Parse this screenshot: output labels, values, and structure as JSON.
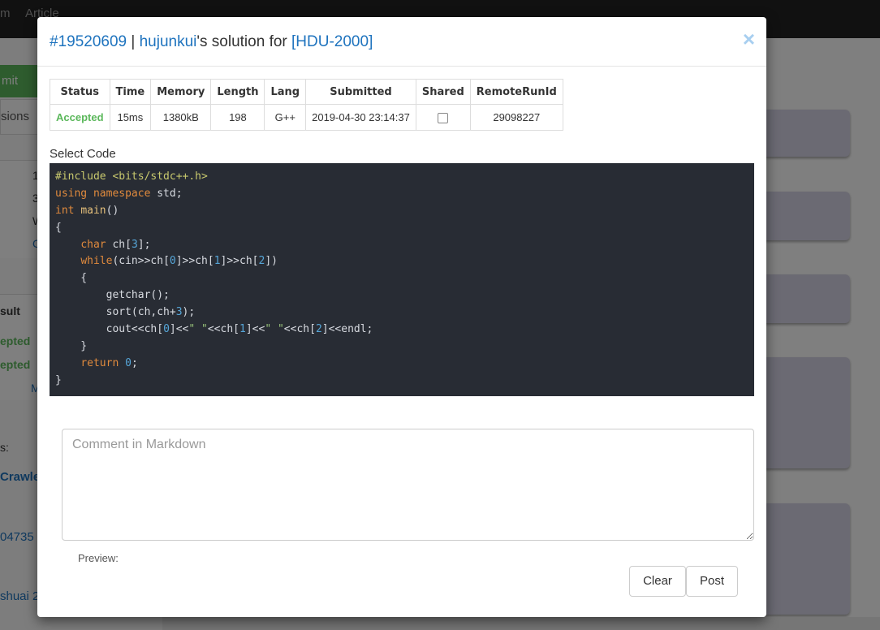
{
  "background": {
    "nav_links": [
      "m",
      "Article"
    ],
    "submit_frag": "mit",
    "tab_frag": "sions",
    "num_frags": [
      "1",
      "3",
      "W",
      "C"
    ],
    "result_header": "sult",
    "result_rows": [
      "epted",
      "epted"
    ],
    "more_frag": "M",
    "label_frag": "s:",
    "link_frag": "Crawle",
    "num_frag": "04735",
    "name_frag": "shuai 2"
  },
  "modal": {
    "title": {
      "run_id": "#19520609",
      "sep": " | ",
      "user": "hujunkui",
      "mid": "'s solution for ",
      "problem": "[HDU-2000]"
    },
    "close_label": "×",
    "table": {
      "headers": [
        "Status",
        "Time",
        "Memory",
        "Length",
        "Lang",
        "Submitted",
        "Shared",
        "RemoteRunId"
      ],
      "row": {
        "status": "Accepted",
        "time": "15ms",
        "memory": "1380kB",
        "length": "198",
        "lang": "G++",
        "submitted": "2019-04-30 23:14:37",
        "remote_run_id": "29098227"
      }
    },
    "select_code_label": "Select Code",
    "comment_placeholder": "Comment in Markdown",
    "preview_label": "Preview:",
    "clear_label": "Clear",
    "post_label": "Post"
  },
  "code_lines": [
    [
      {
        "t": "#include <bits/stdc++.h>",
        "c": "pre"
      }
    ],
    [
      {
        "t": "using namespace",
        "c": "kw"
      },
      {
        "t": " std;",
        "c": ""
      }
    ],
    [
      {
        "t": "int",
        "c": "kw"
      },
      {
        "t": " ",
        "c": ""
      },
      {
        "t": "main",
        "c": "fn"
      },
      {
        "t": "()",
        "c": ""
      }
    ],
    [
      {
        "t": "{",
        "c": ""
      }
    ],
    [
      {
        "t": "    ",
        "c": ""
      },
      {
        "t": "char",
        "c": "kw"
      },
      {
        "t": " ch[",
        "c": ""
      },
      {
        "t": "3",
        "c": "num"
      },
      {
        "t": "];",
        "c": ""
      }
    ],
    [
      {
        "t": "    ",
        "c": ""
      },
      {
        "t": "while",
        "c": "kw"
      },
      {
        "t": "(cin>>ch[",
        "c": ""
      },
      {
        "t": "0",
        "c": "num"
      },
      {
        "t": "]>>ch[",
        "c": ""
      },
      {
        "t": "1",
        "c": "num"
      },
      {
        "t": "]>>ch[",
        "c": ""
      },
      {
        "t": "2",
        "c": "num"
      },
      {
        "t": "])",
        "c": ""
      }
    ],
    [
      {
        "t": "    {",
        "c": ""
      }
    ],
    [
      {
        "t": "        getchar();",
        "c": ""
      }
    ],
    [
      {
        "t": "        sort(ch,ch+",
        "c": ""
      },
      {
        "t": "3",
        "c": "num"
      },
      {
        "t": ");",
        "c": ""
      }
    ],
    [
      {
        "t": "        cout<<ch[",
        "c": ""
      },
      {
        "t": "0",
        "c": "num"
      },
      {
        "t": "]<<",
        "c": ""
      },
      {
        "t": "\" \"",
        "c": "str"
      },
      {
        "t": "<<ch[",
        "c": ""
      },
      {
        "t": "1",
        "c": "num"
      },
      {
        "t": "]<<",
        "c": ""
      },
      {
        "t": "\" \"",
        "c": "str"
      },
      {
        "t": "<<ch[",
        "c": ""
      },
      {
        "t": "2",
        "c": "num"
      },
      {
        "t": "]<<endl;",
        "c": ""
      }
    ],
    [
      {
        "t": "    }",
        "c": ""
      }
    ],
    [
      {
        "t": "    ",
        "c": ""
      },
      {
        "t": "return",
        "c": "kw"
      },
      {
        "t": " ",
        "c": ""
      },
      {
        "t": "0",
        "c": "num"
      },
      {
        "t": ";",
        "c": ""
      }
    ],
    [
      {
        "t": "}",
        "c": ""
      }
    ]
  ]
}
